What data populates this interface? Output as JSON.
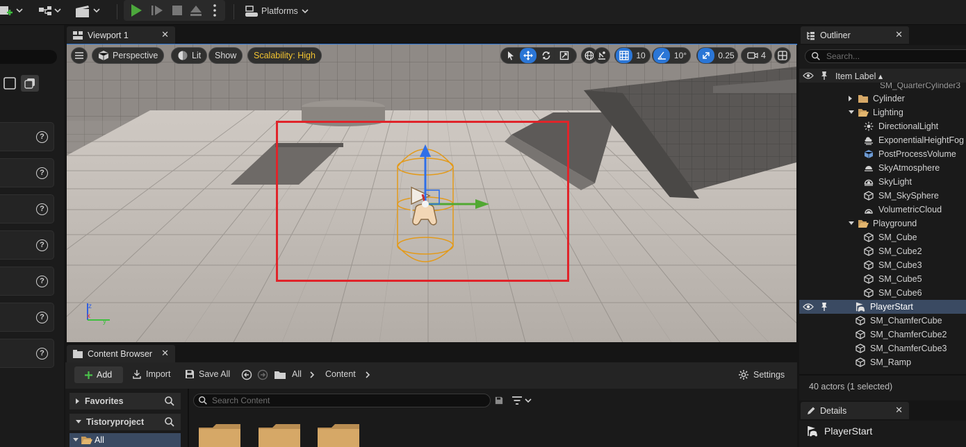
{
  "toolbar": {
    "platforms_label": "Platforms",
    "accent_play": "#4ca83c"
  },
  "viewport": {
    "tab_label": "Viewport 1",
    "perspective_label": "Perspective",
    "lit_label": "Lit",
    "show_label": "Show",
    "scalability_label": "Scalability: High",
    "grid_snap_value": "10",
    "rotation_snap_value": "10°",
    "scale_snap_value": "0.25",
    "camera_speed_value": "4",
    "selection_box_color": "#e0242a"
  },
  "content_browser": {
    "tab_label": "Content Browser",
    "add_label": "Add",
    "import_label": "Import",
    "save_all_label": "Save All",
    "breadcrumb": [
      "All",
      "Content"
    ],
    "settings_label": "Settings",
    "search_placeholder": "Search Content",
    "tree": {
      "favorites_label": "Favorites",
      "project_label": "Tistoryproject",
      "all_label": "All"
    }
  },
  "outliner": {
    "tab_label": "Outliner",
    "search_placeholder": "Search...",
    "column_label": "Item Label ▴",
    "items": [
      {
        "label": "Cylinder",
        "type": "folder",
        "collapsed": true
      },
      {
        "label": "Lighting",
        "type": "folder",
        "collapsed": false
      },
      {
        "label": "DirectionalLight",
        "type": "sun-icon"
      },
      {
        "label": "ExponentialHeightFog",
        "type": "fog-icon"
      },
      {
        "label": "PostProcessVolume",
        "type": "volume-icon"
      },
      {
        "label": "SkyAtmosphere",
        "type": "atmosphere-icon"
      },
      {
        "label": "SkyLight",
        "type": "skylight-icon"
      },
      {
        "label": "SM_SkySphere",
        "type": "mesh-icon"
      },
      {
        "label": "VolumetricCloud",
        "type": "cloud-icon"
      },
      {
        "label": "Playground",
        "type": "folder",
        "collapsed": false
      },
      {
        "label": "SM_Cube",
        "type": "mesh-icon"
      },
      {
        "label": "SM_Cube2",
        "type": "mesh-icon"
      },
      {
        "label": "SM_Cube3",
        "type": "mesh-icon"
      },
      {
        "label": "SM_Cube5",
        "type": "mesh-icon"
      },
      {
        "label": "SM_Cube6",
        "type": "mesh-icon"
      },
      {
        "label": "PlayerStart",
        "type": "player-start-icon",
        "selected": true
      },
      {
        "label": "SM_ChamferCube",
        "type": "mesh-icon"
      },
      {
        "label": "SM_ChamferCube2",
        "type": "mesh-icon"
      },
      {
        "label": "SM_ChamferCube3",
        "type": "mesh-icon"
      },
      {
        "label": "SM_Ramp",
        "type": "mesh-icon"
      }
    ],
    "status": "40 actors (1 selected)"
  },
  "details": {
    "tab_label": "Details",
    "actor_name": "PlayerStart"
  }
}
